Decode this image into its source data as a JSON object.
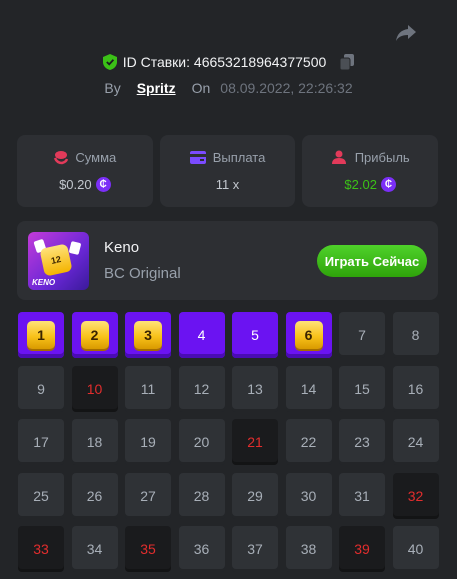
{
  "header": {
    "bet_id": "ID Ставки: 46653218964377500",
    "by_label": "By",
    "username": "Spritz",
    "on_label": "On",
    "datetime": "08.09.2022, 22:26:32"
  },
  "stats": [
    {
      "label": "Сумма",
      "value": "$0.20",
      "icon": "coins-icon",
      "color": "#e23a5a"
    },
    {
      "label": "Выплата",
      "value": "11 x",
      "icon": "wallet-icon",
      "color": "#7b4bff"
    },
    {
      "label": "Прибыль",
      "value": "$2.02",
      "icon": "profit-user-icon",
      "color": "#e23a5a"
    }
  ],
  "coin_symbol": "₵",
  "game": {
    "title": "Keno",
    "subtitle": "BC Original",
    "thumb_label": "KENO",
    "thumb_number": "12",
    "play_label": "Играть Сейчас"
  },
  "board": {
    "hits": [
      1,
      2,
      3,
      6
    ],
    "wins": [
      4,
      5
    ],
    "picked": [
      10,
      21,
      32,
      33,
      35,
      39
    ],
    "cells": [
      "1",
      "2",
      "3",
      "4",
      "5",
      "6",
      "7",
      "8",
      "9",
      "10",
      "11",
      "12",
      "13",
      "14",
      "15",
      "16",
      "17",
      "18",
      "19",
      "20",
      "21",
      "22",
      "23",
      "24",
      "25",
      "26",
      "27",
      "28",
      "29",
      "30",
      "31",
      "32",
      "33",
      "34",
      "35",
      "36",
      "37",
      "38",
      "39",
      "40"
    ]
  },
  "colors": {
    "accent": "#6b13f2",
    "win_green": "#3bc117",
    "picked_red": "#e22d2d",
    "background": "#232528"
  }
}
